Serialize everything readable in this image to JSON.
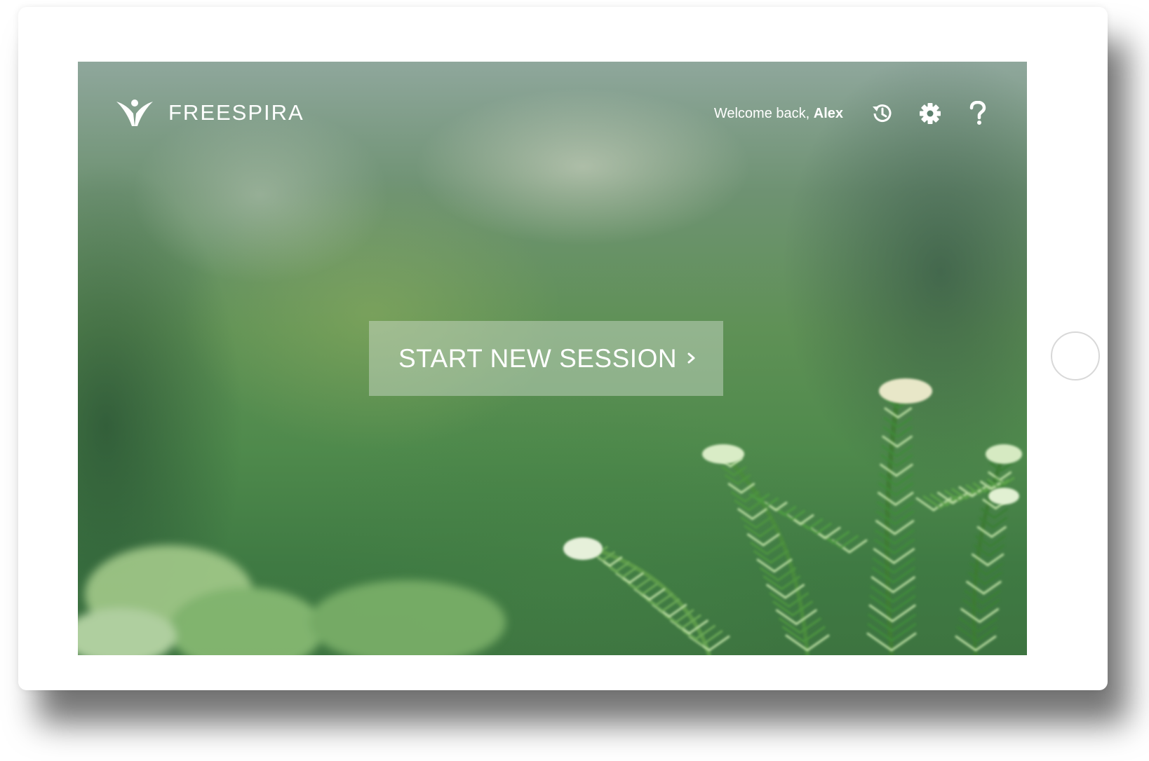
{
  "app": {
    "brand": "FREESPIRA"
  },
  "header": {
    "welcome_prefix": "Welcome back, ",
    "user_name": "Alex",
    "icons": [
      "history-icon",
      "settings-gear-icon",
      "help-question-icon"
    ]
  },
  "main": {
    "start_button_label": "START NEW SESSION",
    "start_button_icon": "chevron-right-icon"
  },
  "colors": {
    "text": "#ffffff",
    "button_overlay": "rgba(220,228,220,0.42)",
    "background_green": "#4f8a4c"
  }
}
